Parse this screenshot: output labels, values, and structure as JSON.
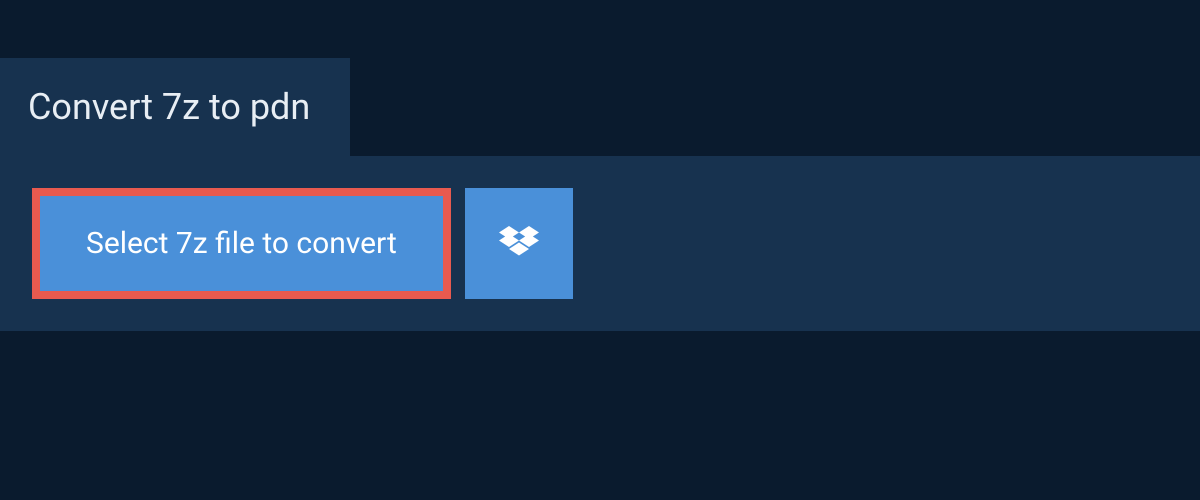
{
  "tab": {
    "title": "Convert 7z to pdn"
  },
  "actions": {
    "select_file_label": "Select 7z file to convert"
  },
  "colors": {
    "background": "#0a1b2e",
    "panel": "#17324f",
    "button": "#4a90d9",
    "highlight_border": "#e85a4f",
    "text_light": "#e8eef4",
    "text_white": "#ffffff"
  }
}
